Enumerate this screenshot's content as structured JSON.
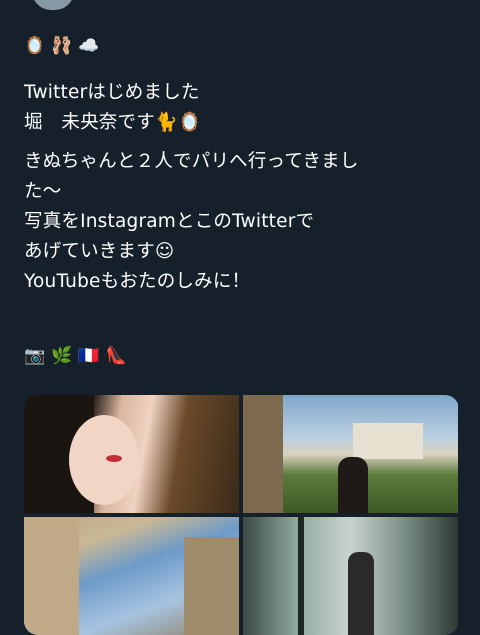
{
  "profile": {
    "avatar_icon": "avatar-icon"
  },
  "bio_emoji": [
    "🪞",
    "🩰",
    "☁️"
  ],
  "bio_lines": [
    "Twitterはじめました",
    "堀　未央奈です🐈🪞"
  ],
  "body_lines": [
    "きぬちゃんと２人でパリへ行ってきまし",
    "た〜",
    "写真をInstagramとこのTwitterで",
    "あげていきます☺︎",
    "YouTubeもおたのしみに！"
  ],
  "footer_emoji": [
    "📷",
    "🌿",
    "🇫🇷",
    "👠"
  ],
  "media": [
    {
      "description": "selfie-closeup"
    },
    {
      "description": "garden-building"
    },
    {
      "description": "paris-buildings-sky"
    },
    {
      "description": "mirror-selfie"
    }
  ]
}
